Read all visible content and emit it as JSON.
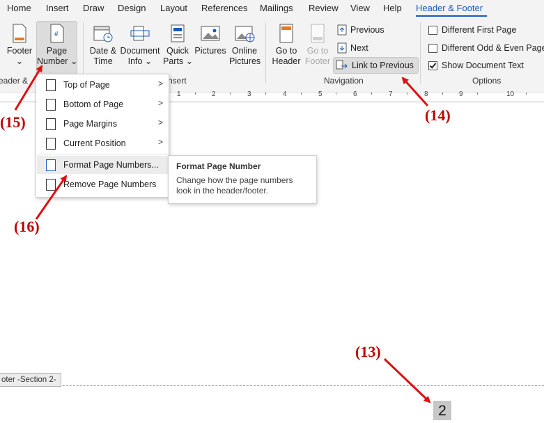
{
  "tabs": [
    "Home",
    "Insert",
    "Draw",
    "Design",
    "Layout",
    "References",
    "Mailings",
    "Review",
    "View",
    "Help",
    "Header & Footer"
  ],
  "active_tab": "Header & Footer",
  "ribbon": {
    "footer": "Footer",
    "page_number_line1": "Page",
    "page_number_line2": "Number",
    "date_time_line1": "Date &",
    "date_time_line2": "Time",
    "doc_info_line1": "Document",
    "doc_info_line2": "Info",
    "quick_parts_line1": "Quick",
    "quick_parts_line2": "Parts",
    "pictures": "Pictures",
    "online_pictures_line1": "Online",
    "online_pictures_line2": "Pictures",
    "goto_header_line1": "Go to",
    "goto_header_line2": "Header",
    "goto_footer_line1": "Go to",
    "goto_footer_line2": "Footer",
    "previous": "Previous",
    "next": "Next",
    "link_to_previous": "Link to Previous",
    "different_first_page": "Different First Page",
    "different_odd_even": "Different Odd & Even Pages",
    "show_document_text": "Show Document Text",
    "group_header_footer": "eader &",
    "group_insert": "nsert",
    "group_navigation": "Navigation",
    "group_options": "Options"
  },
  "checkboxes": {
    "different_first_page": false,
    "different_odd_even": false,
    "show_document_text": true
  },
  "ruler": [
    "1",
    "2",
    "3",
    "4",
    "5",
    "6",
    "7",
    "8",
    "9",
    "10"
  ],
  "menu": {
    "items": [
      {
        "label": "Top of Page",
        "has_submenu": true
      },
      {
        "label": "Bottom of Page",
        "has_submenu": true
      },
      {
        "label": "Page Margins",
        "has_submenu": true
      },
      {
        "label": "Current Position",
        "has_submenu": true
      },
      {
        "label": "Format Page Numbers...",
        "has_submenu": false
      },
      {
        "label": "Remove Page Numbers",
        "has_submenu": false
      }
    ]
  },
  "tooltip": {
    "title": "Format Page Number",
    "body": "Change how the page numbers look in the header/footer."
  },
  "document": {
    "footer_tag": "oter -Section 2-",
    "page_number": "2"
  },
  "annotations": [
    "(13)",
    "(14)",
    "(15)",
    "(16)"
  ],
  "colors": {
    "accent": "#185abd",
    "annotation": "#c00000"
  }
}
